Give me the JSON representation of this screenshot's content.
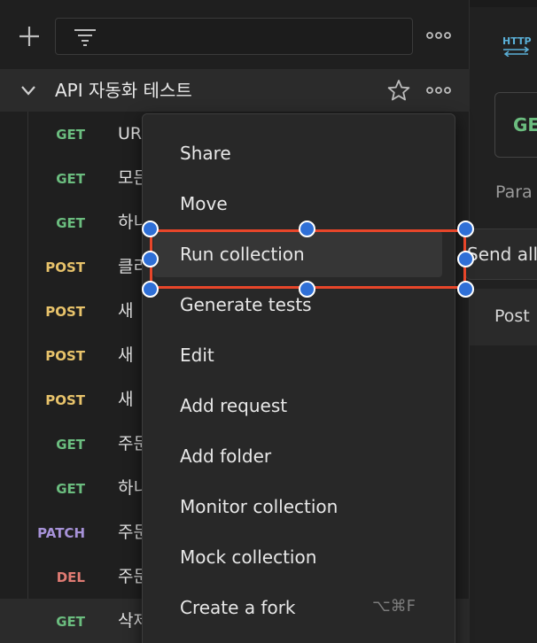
{
  "sidebar": {
    "collection_name": "API 자동화 테스트",
    "requests": [
      {
        "method": "GET",
        "name": "UR"
      },
      {
        "method": "GET",
        "name": "모든"
      },
      {
        "method": "GET",
        "name": "하니"
      },
      {
        "method": "POST",
        "name": "클리"
      },
      {
        "method": "POST",
        "name": "새"
      },
      {
        "method": "POST",
        "name": "새"
      },
      {
        "method": "POST",
        "name": "새"
      },
      {
        "method": "GET",
        "name": "주문"
      },
      {
        "method": "GET",
        "name": "하니"
      },
      {
        "method": "PATCH",
        "name": "주문"
      },
      {
        "method": "DEL",
        "name": "주문"
      },
      {
        "method": "GET",
        "name": "삭제"
      }
    ]
  },
  "right_panel": {
    "http_icon_label": "HTTP",
    "method_label": "GE",
    "params_label": "Para",
    "send_all_label": "Send all",
    "post_label": "Post"
  },
  "context_menu": {
    "items": [
      {
        "label": "Share",
        "shortcut": ""
      },
      {
        "label": "Move",
        "shortcut": ""
      },
      {
        "label": "Run collection",
        "shortcut": ""
      },
      {
        "label": "Generate tests",
        "shortcut": ""
      },
      {
        "label": "Edit",
        "shortcut": ""
      },
      {
        "label": "Add request",
        "shortcut": ""
      },
      {
        "label": "Add folder",
        "shortcut": ""
      },
      {
        "label": "Monitor collection",
        "shortcut": ""
      },
      {
        "label": "Mock collection",
        "shortcut": ""
      },
      {
        "label": "Create a fork",
        "shortcut": "⌥⌘F"
      }
    ],
    "active_item": "Run collection"
  },
  "colors": {
    "get": "#6bbd7f",
    "post": "#e8c36b",
    "patch": "#a792d8",
    "del": "#e07b73",
    "selection": "#e8462a",
    "handle": "#2f6fd6"
  }
}
